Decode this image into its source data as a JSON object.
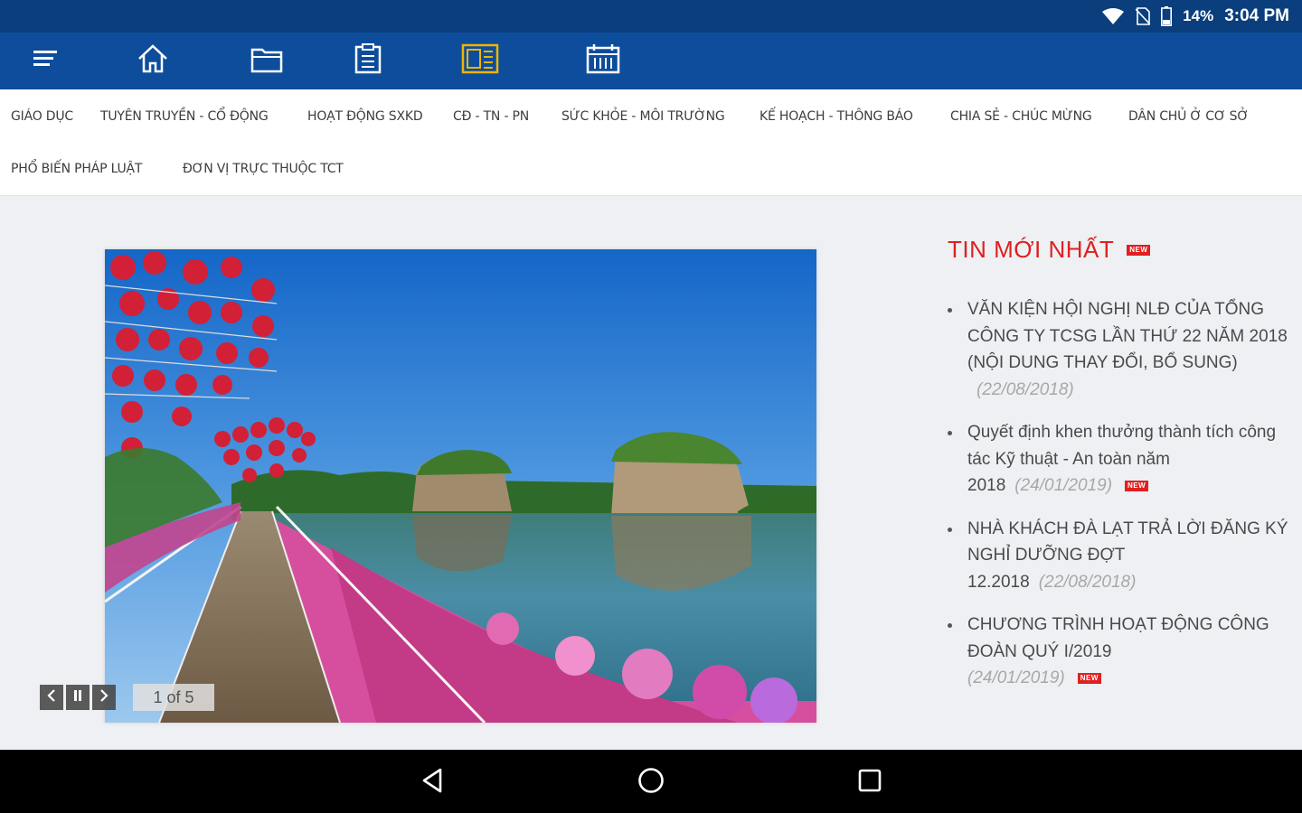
{
  "status_bar": {
    "battery": "14%",
    "time": "3:04 PM",
    "icons": [
      "wifi-icon",
      "no-sim-icon",
      "battery-icon"
    ]
  },
  "toolbar": {
    "icons": [
      "menu-icon",
      "home-icon",
      "folder-icon",
      "clipboard-icon",
      "newspaper-icon",
      "calendar-icon"
    ],
    "active": "newspaper-icon",
    "active_color": "#f0b400"
  },
  "categories": {
    "row1": [
      "GIÁO DỤC",
      "TUYÊN TRUYỀN - CỔ ĐỘNG",
      "HOẠT ĐỘNG SXKD",
      "CĐ - TN - PN",
      "SỨC KHỎE - MÔI TRƯỜNG",
      "KẾ HOẠCH - THÔNG BÁO",
      "CHIA SẺ - CHÚC MỪNG",
      "DÂN CHỦ Ở CƠ SỞ"
    ],
    "row2": [
      "PHỔ BIẾN PHÁP LUẬT",
      "ĐƠN VỊ TRỰC THUỘC TCT"
    ]
  },
  "slideshow": {
    "counter": "1 of 5",
    "prev_icon": "chevron-left-icon",
    "pause_icon": "pause-icon",
    "next_icon": "chevron-right-icon"
  },
  "news": {
    "title": "TIN MỚI NHẤT",
    "badge": "NEW",
    "items": [
      {
        "title": "VĂN KIỆN HỘI NGHỊ NLĐ CỦA TỔNG CÔNG TY TCSG LẦN THỨ 22 NĂM 2018 (NỘI DUNG THAY ĐỔI, BỔ SUNG)",
        "date": "(22/08/2018)",
        "is_new": false
      },
      {
        "title": "Quyết định khen thưởng thành tích công tác Kỹ thuật - An toàn năm 2018",
        "date": "(24/01/2019)",
        "is_new": true
      },
      {
        "title": "NHÀ KHÁCH ĐÀ LẠT TRẢ LỜI ĐĂNG KÝ NGHỈ DƯỠNG ĐỢT 12.2018",
        "date": "(22/08/2018)",
        "is_new": false
      },
      {
        "title": "CHƯƠNG TRÌNH HOẠT ĐỘNG CÔNG ĐOÀN QUÝ I/2019",
        "date": "(24/01/2019)",
        "is_new": true
      }
    ],
    "accent_color": "#e02020"
  },
  "nav_bar": {
    "icons": [
      "back-icon",
      "home-circle-icon",
      "recents-icon"
    ]
  }
}
